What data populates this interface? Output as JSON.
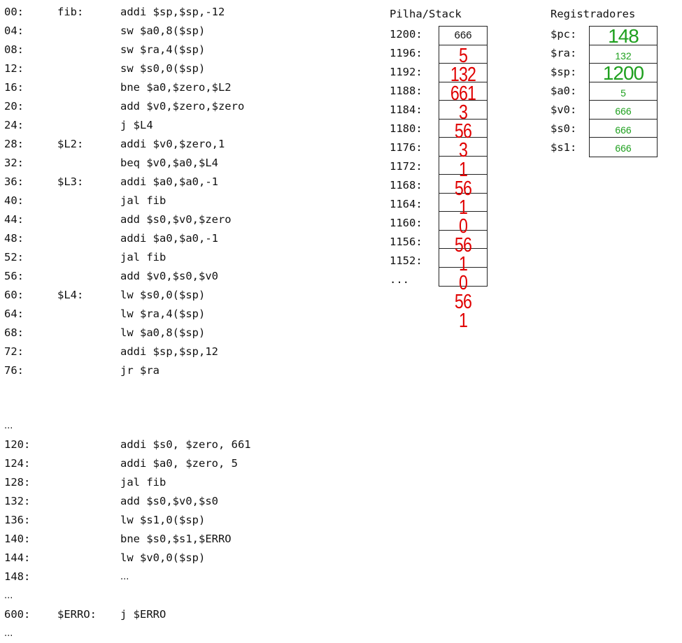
{
  "code": [
    {
      "addr": "00:",
      "label": "fib:",
      "instr": "addi $sp,$sp,-12"
    },
    {
      "addr": "04:",
      "label": "",
      "instr": "sw $a0,8($sp)"
    },
    {
      "addr": "08:",
      "label": "",
      "instr": "sw $ra,4($sp)"
    },
    {
      "addr": "12:",
      "label": "",
      "instr": "sw $s0,0($sp)"
    },
    {
      "addr": "16:",
      "label": "",
      "instr": "bne $a0,$zero,$L2"
    },
    {
      "addr": "20:",
      "label": "",
      "instr": "add $v0,$zero,$zero"
    },
    {
      "addr": "24:",
      "label": "",
      "instr": "j $L4"
    },
    {
      "addr": "28:",
      "label": "$L2:",
      "instr": "addi $v0,$zero,1"
    },
    {
      "addr": "32:",
      "label": "",
      "instr": "beq $v0,$a0,$L4"
    },
    {
      "addr": "36:",
      "label": "$L3:",
      "instr": "addi $a0,$a0,-1"
    },
    {
      "addr": "40:",
      "label": "",
      "instr": "jal fib"
    },
    {
      "addr": "44:",
      "label": "",
      "instr": "add $s0,$v0,$zero"
    },
    {
      "addr": "48:",
      "label": "",
      "instr": "addi $a0,$a0,-1"
    },
    {
      "addr": "52:",
      "label": "",
      "instr": "jal fib"
    },
    {
      "addr": "56:",
      "label": "",
      "instr": "add $v0,$s0,$v0"
    },
    {
      "addr": "60:",
      "label": "$L4:",
      "instr": "lw $s0,0($sp)"
    },
    {
      "addr": "64:",
      "label": "",
      "instr": "lw $ra,4($sp)"
    },
    {
      "addr": "68:",
      "label": "",
      "instr": "lw $a0,8($sp)"
    },
    {
      "addr": "72:",
      "label": "",
      "instr": "addi $sp,$sp,12"
    },
    {
      "addr": "76:",
      "label": "",
      "instr": "jr $ra"
    },
    {
      "gap": true
    },
    {
      "addr": "...",
      "label": "",
      "instr": ""
    },
    {
      "addr": "120:",
      "label": "",
      "instr": "addi $s0, $zero, 661"
    },
    {
      "addr": "124:",
      "label": "",
      "instr": "addi $a0, $zero, 5"
    },
    {
      "addr": "128:",
      "label": "",
      "instr": "jal fib"
    },
    {
      "addr": "132:",
      "label": "",
      "instr": "add $s0,$v0,$s0"
    },
    {
      "addr": "136:",
      "label": "",
      "instr": "lw $s1,0($sp)"
    },
    {
      "addr": "140:",
      "label": "",
      "instr": "bne $s0,$s1,$ERRO"
    },
    {
      "addr": "144:",
      "label": "",
      "instr": "lw $v0,0($sp)"
    },
    {
      "addr": "148:",
      "label": "",
      "instr": "..."
    },
    {
      "addr": "...",
      "label": "",
      "instr": ""
    },
    {
      "addr": "600:",
      "label": "$ERRO:",
      "instr": "j $ERRO"
    },
    {
      "addr": "...",
      "label": "",
      "instr": ""
    }
  ],
  "stack": {
    "title": "Pilha/Stack",
    "addresses": [
      "1200:",
      "1196:",
      "1192:",
      "1188:",
      "1184:",
      "1180:",
      "1176:",
      "1172:",
      "1168:",
      "1164:",
      "1160:",
      "1156:",
      "1152:",
      "..."
    ],
    "initial_top": "666",
    "handwritten": [
      "5",
      "132",
      "661",
      "3",
      "56",
      "3",
      "1",
      "56",
      "1",
      "0",
      "56",
      "1",
      "0",
      "56",
      "1"
    ],
    "handwritten_color": "#e00000"
  },
  "registers": {
    "title": "Registradores",
    "items": [
      {
        "name": "$pc:",
        "value": "148",
        "size": "big"
      },
      {
        "name": "$ra:",
        "value": "132",
        "size": "small"
      },
      {
        "name": "$sp:",
        "value": "1200",
        "size": "big"
      },
      {
        "name": "$a0:",
        "value": "5",
        "size": "small"
      },
      {
        "name": "$v0:",
        "value": "666",
        "size": "small"
      },
      {
        "name": "$s0:",
        "value": "666",
        "size": "small"
      },
      {
        "name": "$s1:",
        "value": "666",
        "size": "small"
      }
    ],
    "value_color": "#1fa01f"
  }
}
